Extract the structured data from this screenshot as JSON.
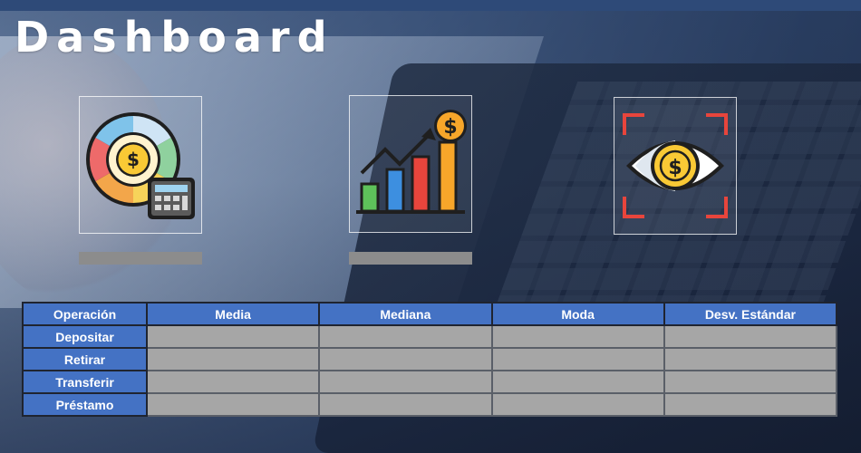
{
  "page": {
    "title": "Dashboard"
  },
  "colors": {
    "header_blue": "#4472c4",
    "cell_gray": "#a6a6a6",
    "placeholder_gray": "#8c8c8c"
  },
  "cards": [
    {
      "icon": "money-pie-calculator-icon"
    },
    {
      "icon": "growth-chart-dollar-icon"
    },
    {
      "icon": "dollar-eye-focus-icon"
    }
  ],
  "table": {
    "headers": [
      "Operación",
      "Media",
      "Mediana",
      "Moda",
      "Desv. Estándar"
    ],
    "rows": [
      {
        "label": "Depositar",
        "values": [
          "",
          "",
          "",
          ""
        ]
      },
      {
        "label": "Retirar",
        "values": [
          "",
          "",
          "",
          ""
        ]
      },
      {
        "label": "Transferir",
        "values": [
          "",
          "",
          "",
          ""
        ]
      },
      {
        "label": "Préstamo",
        "values": [
          "",
          "",
          "",
          ""
        ]
      }
    ]
  }
}
